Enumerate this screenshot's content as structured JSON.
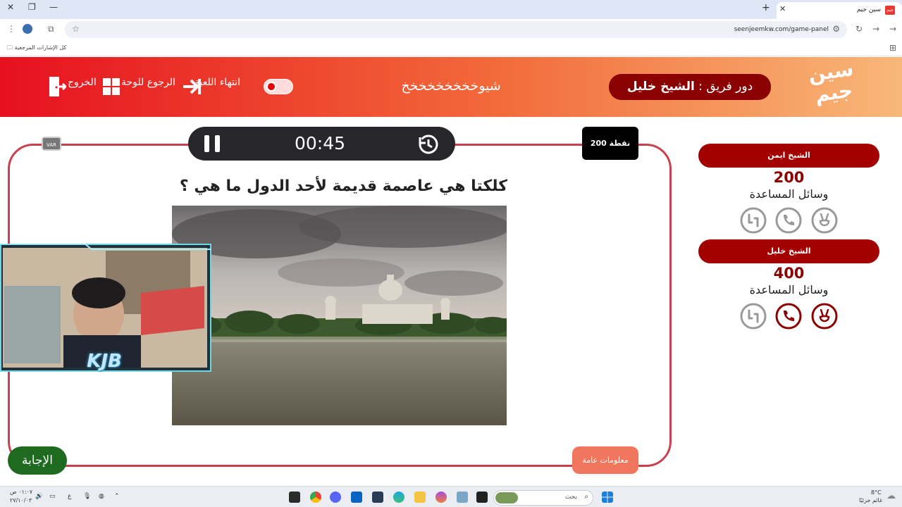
{
  "browser": {
    "tab_title": "سين جيم",
    "favicon_text": "سين جيم",
    "url": "seenjeemkw.com/game-panel",
    "bookmarks_all": "كل الإشارات المرجعية"
  },
  "header": {
    "logo_line1": "سين",
    "logo_line2": "جيم",
    "turn_prefix": "دور فريق : ",
    "turn_team": "الشيخ خليل",
    "game_name": "شيوخخخخخخخخخ",
    "end_game": "انتهاء اللعبة",
    "back_to_board": "الرجوع للوحة",
    "exit": "الخروج"
  },
  "board": {
    "timer": "00:45",
    "points": "200 نقطة",
    "var": "VAR",
    "question": "كلكتا هي عاصمة قديمة لأحد الدول ما هي ؟",
    "category": "معلومات عامة",
    "answer": "الإجابة"
  },
  "webcam": {
    "overlay_logo": "KJB"
  },
  "teams": [
    {
      "name": "الشيخ ايمن",
      "score": "200",
      "aids_label": "وسائل المساعدة",
      "aids": [
        "two-answers-icon",
        "phone-icon",
        "peace-hand-icon"
      ],
      "aids_used": [
        false,
        false,
        false
      ]
    },
    {
      "name": "الشيخ خليل",
      "score": "400",
      "aids_label": "وسائل المساعدة",
      "aids": [
        "two-answers-icon",
        "phone-icon",
        "peace-hand-icon"
      ],
      "aids_used": [
        false,
        true,
        true
      ]
    }
  ],
  "taskbar": {
    "search_placeholder": "بحث",
    "weather_temp": "8°C",
    "weather_desc": "غائم جزئيًا",
    "clock_time": "٠١:٠٧ ص",
    "clock_date": "٢٧/١٠/٠٣",
    "lang": "ع"
  },
  "colors": {
    "header_left": "#e6101f",
    "header_right": "#f8b878",
    "team_pill": "#a30000",
    "board_border": "#c8414f",
    "answer_button": "#1e6a1e",
    "category_button": "#f0765e"
  }
}
